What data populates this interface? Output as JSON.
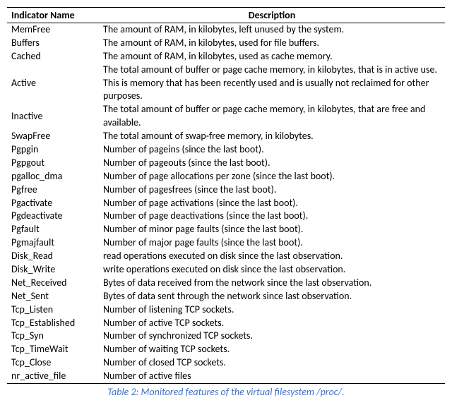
{
  "table": {
    "header": {
      "col1": "Indicator Name",
      "col2": "Description"
    },
    "rows": [
      {
        "name": "MemFree",
        "desc": "The amount of RAM, in kilobytes, left unused by the system."
      },
      {
        "name": "Buffers",
        "desc": "The amount of RAM, in kilobytes, used for file buffers."
      },
      {
        "name": "Cached",
        "desc": "The amount of RAM, in kilobytes, used as cache memory."
      },
      {
        "name": "Active",
        "desc": "The total amount of buffer or page cache memory, in kilobytes, that is in active use. This is memory that has been recently used and is usually not reclaimed for other purposes."
      },
      {
        "name": "Inactive",
        "desc": "The total amount of buffer or page cache memory, in kilobytes, that are free and available."
      },
      {
        "name": "SwapFree",
        "desc": "The total amount of swap-free memory, in kilobytes."
      },
      {
        "name": "Pgpgin",
        "desc": "Number of pageins (since the last boot)."
      },
      {
        "name": "Pgpgout",
        "desc": "Number of pageouts (since the last boot)."
      },
      {
        "name": "pgalloc_dma",
        "desc": "Number of page allocations per zone (since the last boot)."
      },
      {
        "name": "Pgfree",
        "desc": "Number of pagesfrees (since the last boot)."
      },
      {
        "name": "Pgactivate",
        "desc": "Number of page activations (since the last boot)."
      },
      {
        "name": "Pgdeactivate",
        "desc": "Number of page deactivations (since the last boot)."
      },
      {
        "name": "Pgfault",
        "desc": "Number of minor page faults (since the last boot)."
      },
      {
        "name": "Pgmajfault",
        "desc": "Number of major page faults (since the last boot)."
      },
      {
        "name": "Disk_Read",
        "desc": "read operations executed on disk since the last observation."
      },
      {
        "name": "Disk_Write",
        "desc": "write operations executed on disk since the last observation."
      },
      {
        "name": "Net_Received",
        "desc": "Bytes of data received from the network since the last observation."
      },
      {
        "name": "Net_Sent",
        "desc": "Bytes of data sent through the network since last observation."
      },
      {
        "name": "Tcp_Listen",
        "desc": "Number of listening TCP sockets."
      },
      {
        "name": "Tcp_Established",
        "desc": "Number of active TCP sockets."
      },
      {
        "name": "Tcp_Syn",
        "desc": "Number of synchronized TCP sockets."
      },
      {
        "name": "Tcp_TimeWait",
        "desc": "Number of waiting TCP sockets."
      },
      {
        "name": "Tcp_Close",
        "desc": "Number of closed TCP sockets."
      },
      {
        "name": "nr_active_file",
        "desc": "Number of active files"
      }
    ]
  },
  "caption": "Table 2:  Monitored features of the virtual filesystem /proc/."
}
